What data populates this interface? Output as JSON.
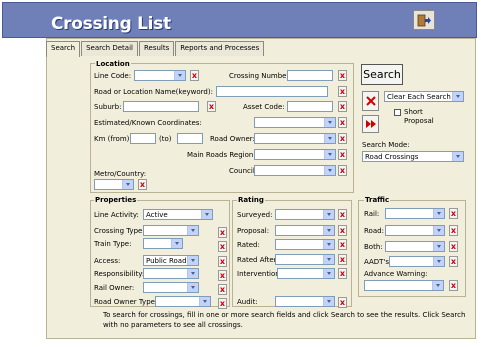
{
  "window": {
    "title": "Crossing List"
  },
  "tabs": [
    "Search",
    "Search Detail",
    "Results",
    "Reports and Processes"
  ],
  "location": {
    "heading": "Location",
    "line_code": "Line Code:",
    "crossing_number": "Crossing Number:",
    "road_location": "Road or Location Name(keyword):",
    "suburb": "Suburb:",
    "asset_code": "Asset Code:",
    "estimated_coords": "Estimated/Known Coordinates:",
    "km_from": "Km (from):",
    "km_to": "(to)",
    "road_owner": "Road Owner:",
    "main_roads_region": "Main Roads Region:",
    "council": "Council:",
    "metro_country": "Metro/Country:"
  },
  "search_panel": {
    "search_label": "Search",
    "clear_option": "Clear Each Search",
    "short_proposal": "Short Proposal",
    "search_mode_label": "Search Mode:",
    "search_mode_value": "Road Crossings"
  },
  "properties": {
    "heading": "Properties",
    "line_activity": "Line Activity:",
    "line_activity_value": "Active",
    "crossing_type": "Crossing Type",
    "train_type": "Train Type:",
    "access": "Access:",
    "access_value": "Public Road",
    "responsibility": "Responsibility:",
    "rail_owner": "Rail Owner:",
    "road_owner_type": "Road Owner Type:"
  },
  "rating": {
    "heading": "Rating",
    "surveyed": "Surveyed:",
    "proposal": "Proposal:",
    "rated": "Rated:",
    "rated_after": "Rated After:",
    "intervention": "Intervention:",
    "audit": "Audit:"
  },
  "traffic": {
    "heading": "Traffic",
    "rail": "Rail:",
    "road": "Road:",
    "both": "Both:",
    "aadts": "AADT's:",
    "advance_warning": "Advance Warning:"
  },
  "help_text": "To search for crossings, fill in one or more search fields and click Search to see the results. Click Search with no parameters to see all crossings.",
  "icons": {
    "exit": "exit-door-icon",
    "clear": "red-x-icon",
    "advance": "fast-forward-icon"
  },
  "colors": {
    "header": "#6f7fb8",
    "panel": "#f1eedb",
    "clear_x": "#d00000",
    "dropdown_arrow": "#c1d3fb"
  }
}
